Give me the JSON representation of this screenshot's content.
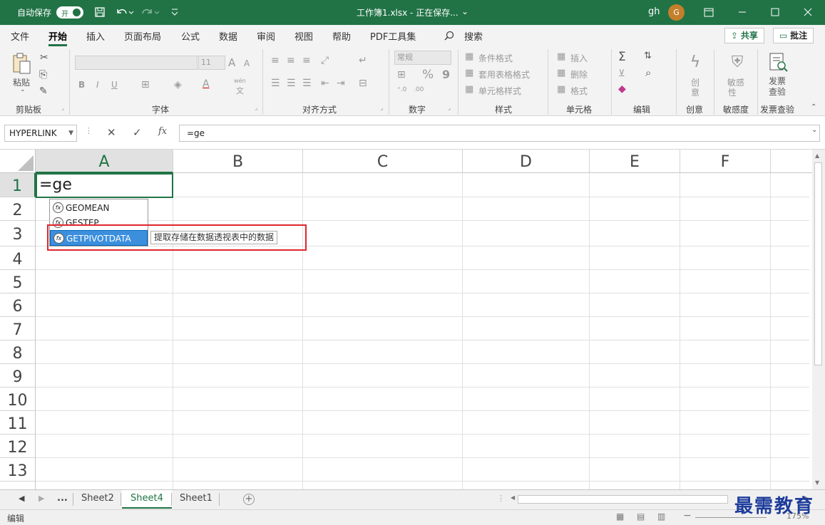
{
  "titlebar": {
    "autosave_label": "自动保存",
    "autosave_state": "开",
    "title": "工作簿1.xlsx  -  正在保存...",
    "title_chevron": "⌄",
    "user_name": "gh",
    "avatar_letter": "G",
    "icons": [
      "save-icon",
      "undo-icon",
      "redo-icon",
      "customize-icon",
      "ribbon-display-icon",
      "minimize-icon",
      "maximize-icon",
      "close-icon"
    ]
  },
  "menu": {
    "tabs": [
      "文件",
      "开始",
      "插入",
      "页面布局",
      "公式",
      "数据",
      "审阅",
      "视图",
      "帮助",
      "PDF工具集"
    ],
    "active_tab": "开始",
    "search_label": "搜索",
    "share_label": "共享",
    "comments_label": "批注"
  },
  "ribbon": {
    "clipboard": {
      "paste": "粘贴",
      "group": "剪贴板"
    },
    "font": {
      "size": "11",
      "group": "字体",
      "grow": "A",
      "shrink": "A",
      "bold": "B",
      "italic": "I",
      "underline": "U",
      "wen": "wén",
      "wen_char": "文"
    },
    "alignment": {
      "group": "对齐方式"
    },
    "number": {
      "format": "常规",
      "percent": "%",
      "comma": "9",
      "group": "数字"
    },
    "styles": {
      "conditional": "条件格式",
      "table": "套用表格格式",
      "cell": "单元格样式",
      "group": "样式"
    },
    "cells": {
      "insert": "插入",
      "delete": "删除",
      "format": "格式",
      "group": "单元格"
    },
    "editing": {
      "group": "编辑"
    },
    "creative": {
      "label1": "创",
      "label2": "意",
      "group": "创意"
    },
    "sensitivity": {
      "label1": "敏感",
      "label2": "性",
      "group": "敏感度"
    },
    "invoice": {
      "label1": "发票",
      "label2": "查验",
      "group": "发票查验"
    }
  },
  "formula_bar": {
    "name_box": "HYPERLINK",
    "cancel": "✕",
    "enter": "✓",
    "fx": "fx",
    "formula": "=ge"
  },
  "grid": {
    "columns": [
      "A",
      "B",
      "C",
      "D",
      "E",
      "F"
    ],
    "rows": [
      "1",
      "2",
      "3",
      "4",
      "5",
      "6",
      "7",
      "8",
      "9",
      "10",
      "11",
      "12",
      "13"
    ],
    "active_cell_value": "=ge",
    "autocomplete": [
      "GEOMEAN",
      "GESTEP",
      "GETPIVOTDATA"
    ],
    "highlighted": "GETPIVOTDATA",
    "tooltip": "提取存储在数据透视表中的数据"
  },
  "sheets": {
    "ellipsis": "...",
    "tabs": [
      "Sheet2",
      "Sheet4",
      "Sheet1"
    ],
    "active": "Sheet4",
    "add": "+"
  },
  "status": {
    "mode": "编辑",
    "zoom": "175%"
  },
  "watermark": "最需教育",
  "colors": {
    "accent": "#217346",
    "highlight": "#3c8fdc",
    "annotation": "#e0262e"
  }
}
